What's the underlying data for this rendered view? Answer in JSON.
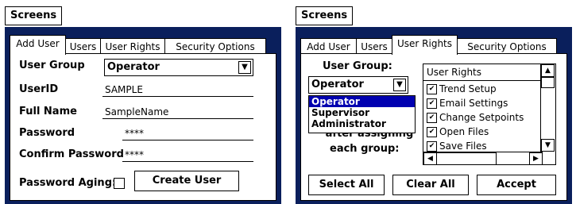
{
  "left": {
    "screens_title": "Screens",
    "tabs": [
      "Add User",
      "Users",
      "User Rights",
      "Security Options"
    ],
    "user_group_label": "User Group",
    "user_group_value": "Operator",
    "userid_label": "UserID",
    "userid_value": "SAMPLE",
    "fullname_label": "Full Name",
    "fullname_value": "SampleName",
    "password_label": "Password",
    "password_value": "****",
    "confirm_label": "Confirm Password",
    "confirm_value": "****",
    "aging_label": "Password Aging:",
    "create_button": "Create User"
  },
  "right": {
    "screens_title": "Screens",
    "tabs": [
      "Add User",
      "Users",
      "User Rights",
      "Security Options"
    ],
    "user_group_label": "User Group:",
    "user_group_value": "Operator",
    "dropdown_options": [
      "Operator",
      "Supervisor",
      "Administrator"
    ],
    "hint_line1": "after assigning",
    "hint_line2": "each group:",
    "rights_header": "User Rights",
    "rights": [
      {
        "label": "Trend Setup",
        "checked": true
      },
      {
        "label": "Email Settings",
        "checked": true
      },
      {
        "label": "Change Setpoints",
        "checked": true
      },
      {
        "label": "Open Files",
        "checked": true
      },
      {
        "label": "Save Files",
        "checked": true
      }
    ],
    "select_all": "Select All",
    "clear_all": "Clear All",
    "accept": "Accept"
  },
  "icons": {
    "check": "✔",
    "down": "▼",
    "up": "▲",
    "left": "◀",
    "right": "▶"
  }
}
